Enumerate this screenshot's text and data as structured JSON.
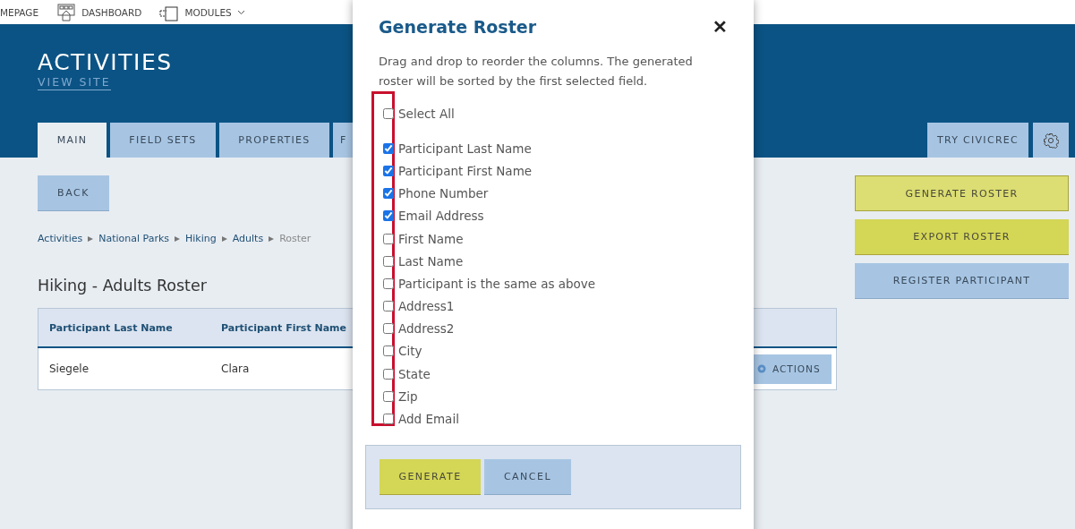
{
  "top_nav": [
    {
      "label": "MEPAGE",
      "dropdown": false
    },
    {
      "label": "DASHBOARD",
      "dropdown": false
    },
    {
      "label": "MODULES",
      "dropdown": true
    }
  ],
  "header": {
    "title": "ACTIVITIES",
    "link": "VIEW SITE"
  },
  "tabs": [
    {
      "label": "MAIN",
      "selected": true
    },
    {
      "label": "FIELD SETS",
      "selected": false
    },
    {
      "label": "PROPERTIES",
      "selected": false
    },
    {
      "label": "F",
      "selected": false
    }
  ],
  "header_actions": {
    "button": "TRY CIVICREC"
  },
  "back_button": "BACK",
  "breadcrumbs": [
    {
      "label": "Activities",
      "current": false
    },
    {
      "label": "National Parks",
      "current": false
    },
    {
      "label": "Hiking",
      "current": false
    },
    {
      "label": "Adults",
      "current": false
    },
    {
      "label": "Roster",
      "current": true
    }
  ],
  "page_title": "Hiking - Adults Roster",
  "table": {
    "columns": [
      "Participant Last Name",
      "Participant First Name"
    ],
    "rows": [
      {
        "cells": [
          "Siegele",
          "Clara"
        ],
        "action": "ACTIONS"
      }
    ]
  },
  "side_buttons": [
    {
      "label": "GENERATE ROSTER",
      "kind": "primary",
      "selected": true
    },
    {
      "label": "EXPORT ROSTER",
      "kind": "primary",
      "selected": false
    },
    {
      "label": "REGISTER PARTICIPANT",
      "kind": "secondary",
      "selected": false
    }
  ],
  "dialog": {
    "title": "Generate Roster",
    "close": "✕",
    "description": "Drag and drop to reorder the columns. The generated roster will be sorted by the first selected field.",
    "select_all": {
      "label": "Select All",
      "checked": false
    },
    "fields": [
      {
        "label": "Participant Last Name",
        "checked": true
      },
      {
        "label": "Participant First Name",
        "checked": true
      },
      {
        "label": "Phone Number",
        "checked": true
      },
      {
        "label": "Email Address",
        "checked": true
      },
      {
        "label": "First Name",
        "checked": false
      },
      {
        "label": "Last Name",
        "checked": false
      },
      {
        "label": "Participant is the same as above",
        "checked": false
      },
      {
        "label": "Address1",
        "checked": false
      },
      {
        "label": "Address2",
        "checked": false
      },
      {
        "label": "City",
        "checked": false
      },
      {
        "label": "State",
        "checked": false
      },
      {
        "label": "Zip",
        "checked": false
      },
      {
        "label": "Add Email",
        "checked": false
      }
    ],
    "buttons": [
      {
        "label": "GENERATE",
        "kind": "primary"
      },
      {
        "label": "CANCEL",
        "kind": "secondary"
      }
    ]
  }
}
